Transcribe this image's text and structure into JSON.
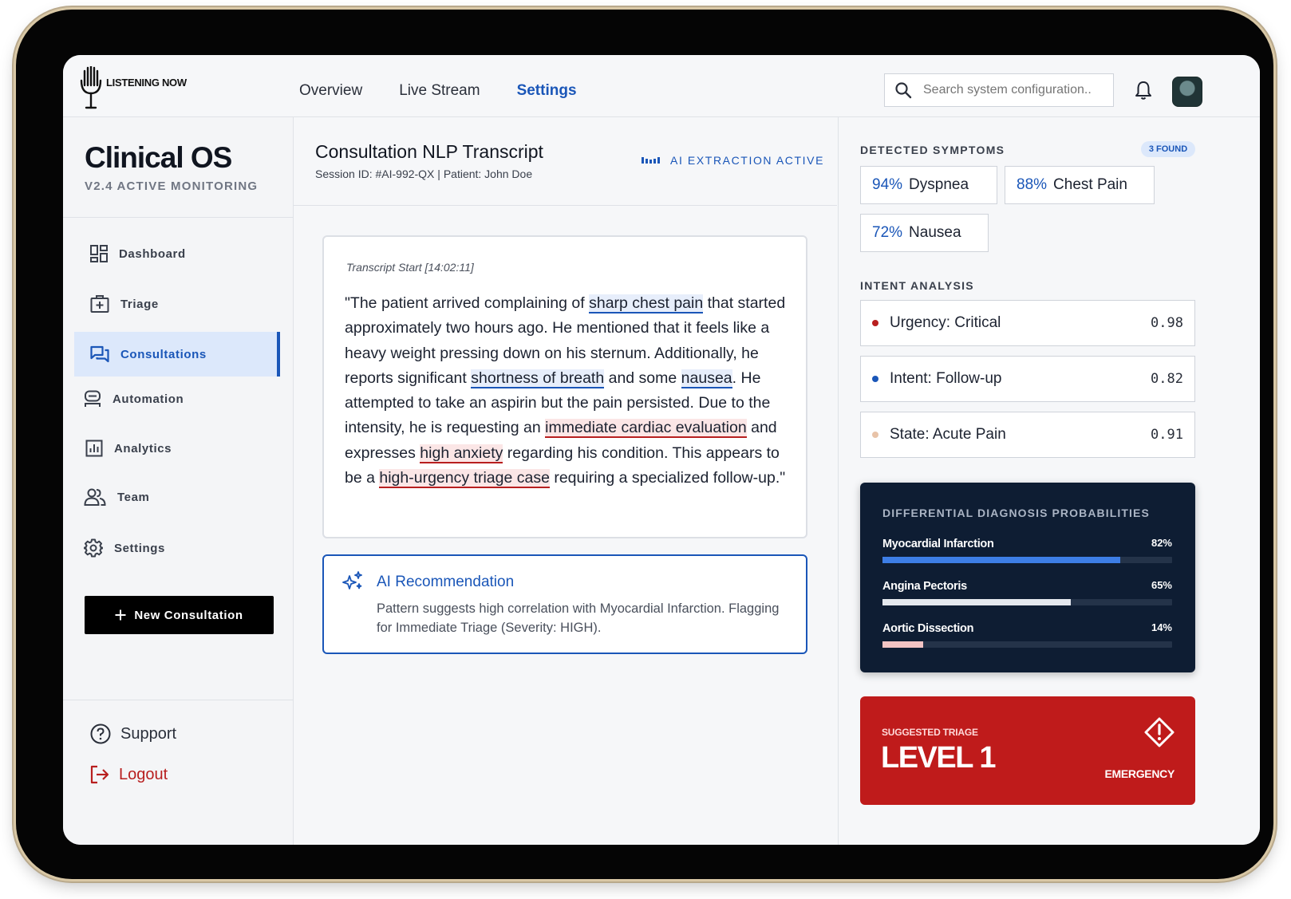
{
  "app": {
    "logo_text": "LISTENING NOW",
    "brand_title": "Clinical OS",
    "brand_subtitle": "V2.4 ACTIVE MONITORING"
  },
  "topnav": {
    "items": [
      {
        "label": "Overview",
        "active": false
      },
      {
        "label": "Live Stream",
        "active": false
      },
      {
        "label": "Settings",
        "active": true
      }
    ],
    "search_placeholder": "Search system configuration..",
    "icons": [
      "search-icon",
      "bell-icon",
      "avatar"
    ]
  },
  "sidebar": {
    "items": [
      {
        "label": "Dashboard",
        "icon": "grid-icon",
        "active": false
      },
      {
        "label": "Triage",
        "icon": "medical-case-icon",
        "active": false
      },
      {
        "label": "Consultations",
        "icon": "chat-icon",
        "active": true
      },
      {
        "label": "Automation",
        "icon": "robot-icon",
        "active": false
      },
      {
        "label": "Analytics",
        "icon": "bar-chart-icon",
        "active": false
      },
      {
        "label": "Team",
        "icon": "people-icon",
        "active": false
      },
      {
        "label": "Settings",
        "icon": "gear-icon",
        "active": false
      }
    ],
    "new_button": "New Consultation",
    "support": "Support",
    "logout": "Logout"
  },
  "transcript": {
    "title": "Consultation NLP Transcript",
    "session": "Session ID: #AI-992-QX | Patient: John Doe",
    "ai_status": "AI EXTRACTION ACTIVE",
    "start_label": "Transcript Start [14:02:11]",
    "segments": [
      {
        "text": "\"The patient arrived complaining of ",
        "hl": ""
      },
      {
        "text": "sharp chest pain",
        "hl": "blue"
      },
      {
        "text": " that started approximately two hours ago. He mentioned that it feels like a heavy weight pressing down on his sternum. Additionally, he reports significant ",
        "hl": ""
      },
      {
        "text": "shortness of breath",
        "hl": "blue"
      },
      {
        "text": " and some ",
        "hl": ""
      },
      {
        "text": "nausea",
        "hl": "blue"
      },
      {
        "text": ". He attempted to take an aspirin but the pain persisted. Due to the intensity, he is requesting an ",
        "hl": ""
      },
      {
        "text": "immediate cardiac evaluation",
        "hl": "red"
      },
      {
        "text": " and expresses ",
        "hl": ""
      },
      {
        "text": "high anxiety",
        "hl": "red"
      },
      {
        "text": " regarding his condition. This appears to be a ",
        "hl": ""
      },
      {
        "text": "high-urgency triage case",
        "hl": "red"
      },
      {
        "text": " requiring a specialized follow-up.\"",
        "hl": ""
      }
    ]
  },
  "recommendation": {
    "title": "AI Recommendation",
    "text": "Pattern suggests high correlation with Myocardial Infarction. Flagging for Immediate Triage (Severity: HIGH)."
  },
  "symptoms": {
    "label": "DETECTED SYMPTOMS",
    "found": "3 FOUND",
    "items": [
      {
        "pct": "94%",
        "name": "Dyspnea"
      },
      {
        "pct": "88%",
        "name": "Chest Pain"
      },
      {
        "pct": "72%",
        "name": "Nausea"
      }
    ]
  },
  "intent": {
    "label": "INTENT ANALYSIS",
    "items": [
      {
        "label": "Urgency: Critical",
        "score": "0.98",
        "color": "#b81f1f"
      },
      {
        "label": "Intent: Follow-up",
        "score": "0.82",
        "color": "#1a56b8"
      },
      {
        "label": "State: Acute Pain",
        "score": "0.91",
        "color": "#e8c3a8"
      }
    ]
  },
  "differential": {
    "title": "DIFFERENTIAL DIAGNOSIS PROBABILITIES",
    "items": [
      {
        "name": "Myocardial Infarction",
        "pct": "82%",
        "value": 0.82,
        "color": "#3d7ee6"
      },
      {
        "name": "Angina Pectoris",
        "pct": "65%",
        "value": 0.65,
        "color": "#e4e8ee"
      },
      {
        "name": "Aortic Dissection",
        "pct": "14%",
        "value": 0.14,
        "color": "#f2c4c4"
      }
    ]
  },
  "triage": {
    "label": "SUGGESTED TRIAGE",
    "level": "LEVEL 1",
    "severity": "EMERGENCY"
  },
  "colors": {
    "accent": "#1a56b8",
    "danger": "#bf1b1b",
    "dark_card": "#0e1d33"
  }
}
